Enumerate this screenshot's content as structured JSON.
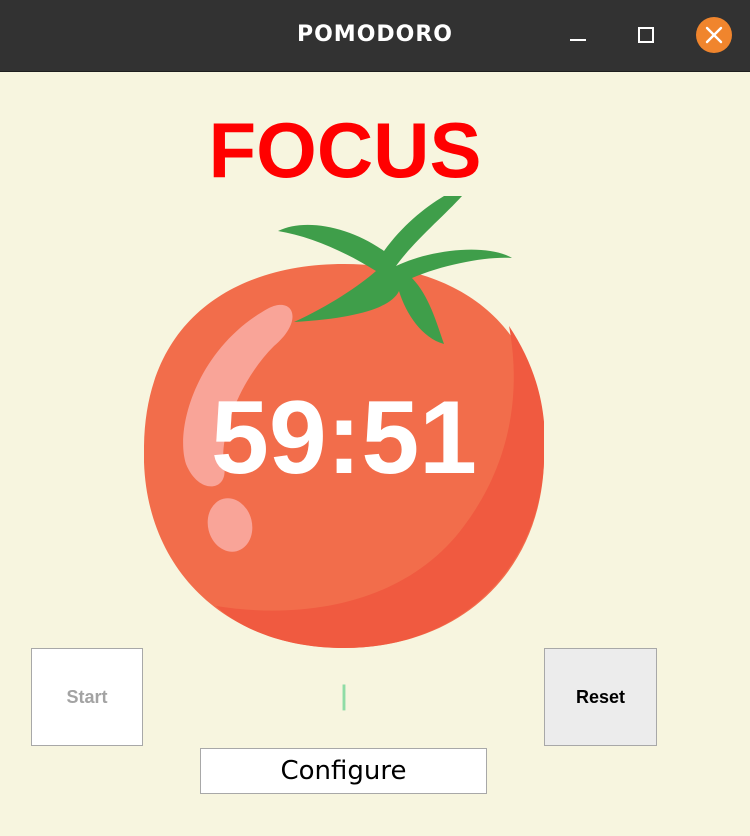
{
  "window": {
    "title": "POMODORO",
    "controls": {
      "minimize_icon": "minimize-icon",
      "maximize_icon": "maximize-icon",
      "close_icon": "close-icon"
    }
  },
  "timer": {
    "mode_label": "FOCUS",
    "time": "59:51",
    "mode_color": "#ff0000",
    "image": "tomato-icon"
  },
  "progress": {
    "checkmarks": "|"
  },
  "buttons": {
    "start_label": "Start",
    "reset_label": "Reset",
    "configure_label": "Configure"
  },
  "colors": {
    "background": "#f7f5df",
    "titlebar": "#323232",
    "close_button": "#f0852d",
    "tomato": "#f26d4b",
    "leaf": "#3f9e4a",
    "checkmark": "#8fdca6"
  }
}
